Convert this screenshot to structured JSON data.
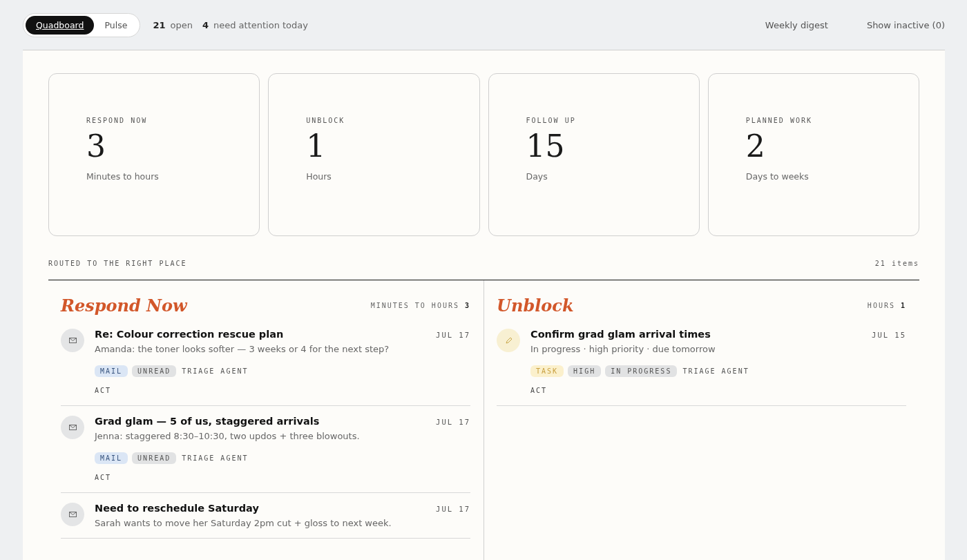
{
  "view_switch": [
    {
      "label": "Quadboard",
      "selected": true
    },
    {
      "label": "Pulse",
      "selected": false
    }
  ],
  "summary": [
    {
      "count": "21",
      "label": "open"
    },
    {
      "count": "4",
      "label": "need attention today"
    }
  ],
  "header_links": [
    "Weekly digest",
    "Show inactive (0)"
  ],
  "stat_cards": [
    {
      "label": "RESPOND NOW",
      "value": "3",
      "caption": "Minutes to hours"
    },
    {
      "label": "UNBLOCK",
      "value": "1",
      "caption": "Hours"
    },
    {
      "label": "FOLLOW UP",
      "value": "15",
      "caption": "Days"
    },
    {
      "label": "PLANNED WORK",
      "value": "2",
      "caption": "Days to weeks"
    }
  ],
  "section": {
    "title": "ROUTED TO THE RIGHT PLACE",
    "count": "21 items"
  },
  "lanes": [
    {
      "title": "Respond Now",
      "range": "MINUTES TO HOURS",
      "count": "3",
      "items": [
        {
          "kind": "mail",
          "title": "Re: Colour correction rescue plan",
          "date": "JUL 17",
          "snippet": "Amanda: the toner looks softer — 3 weeks or 4 for the next step?",
          "tags": [
            {
              "kind": "mail",
              "label": "MAIL"
            },
            {
              "kind": "neutral",
              "label": "UNREAD"
            },
            {
              "kind": "plain",
              "label": "TRIAGE AGENT"
            }
          ],
          "action": "ACT"
        },
        {
          "kind": "mail",
          "title": "Grad glam — 5 of us, staggered arrivals",
          "date": "JUL 17",
          "snippet": "Jenna: staggered 8:30–10:30, two updos + three blowouts.",
          "tags": [
            {
              "kind": "mail",
              "label": "MAIL"
            },
            {
              "kind": "neutral",
              "label": "UNREAD"
            },
            {
              "kind": "plain",
              "label": "TRIAGE AGENT"
            }
          ],
          "action": "ACT"
        },
        {
          "kind": "mail",
          "title": "Need to reschedule Saturday",
          "date": "JUL 17",
          "snippet": "Sarah wants to move her Saturday 2pm cut + gloss to next week."
        }
      ]
    },
    {
      "title": "Unblock",
      "range": "HOURS",
      "count": "1",
      "items": [
        {
          "kind": "task",
          "title": "Confirm grad glam arrival times",
          "date": "JUL 15",
          "snippet": "In progress · high priority · due tomorrow",
          "tags": [
            {
              "kind": "task",
              "label": "TASK"
            },
            {
              "kind": "neutral",
              "label": "HIGH"
            },
            {
              "kind": "neutral",
              "label": "IN PROGRESS"
            },
            {
              "kind": "plain",
              "label": "TRIAGE AGENT"
            }
          ],
          "action": "ACT"
        }
      ]
    }
  ]
}
